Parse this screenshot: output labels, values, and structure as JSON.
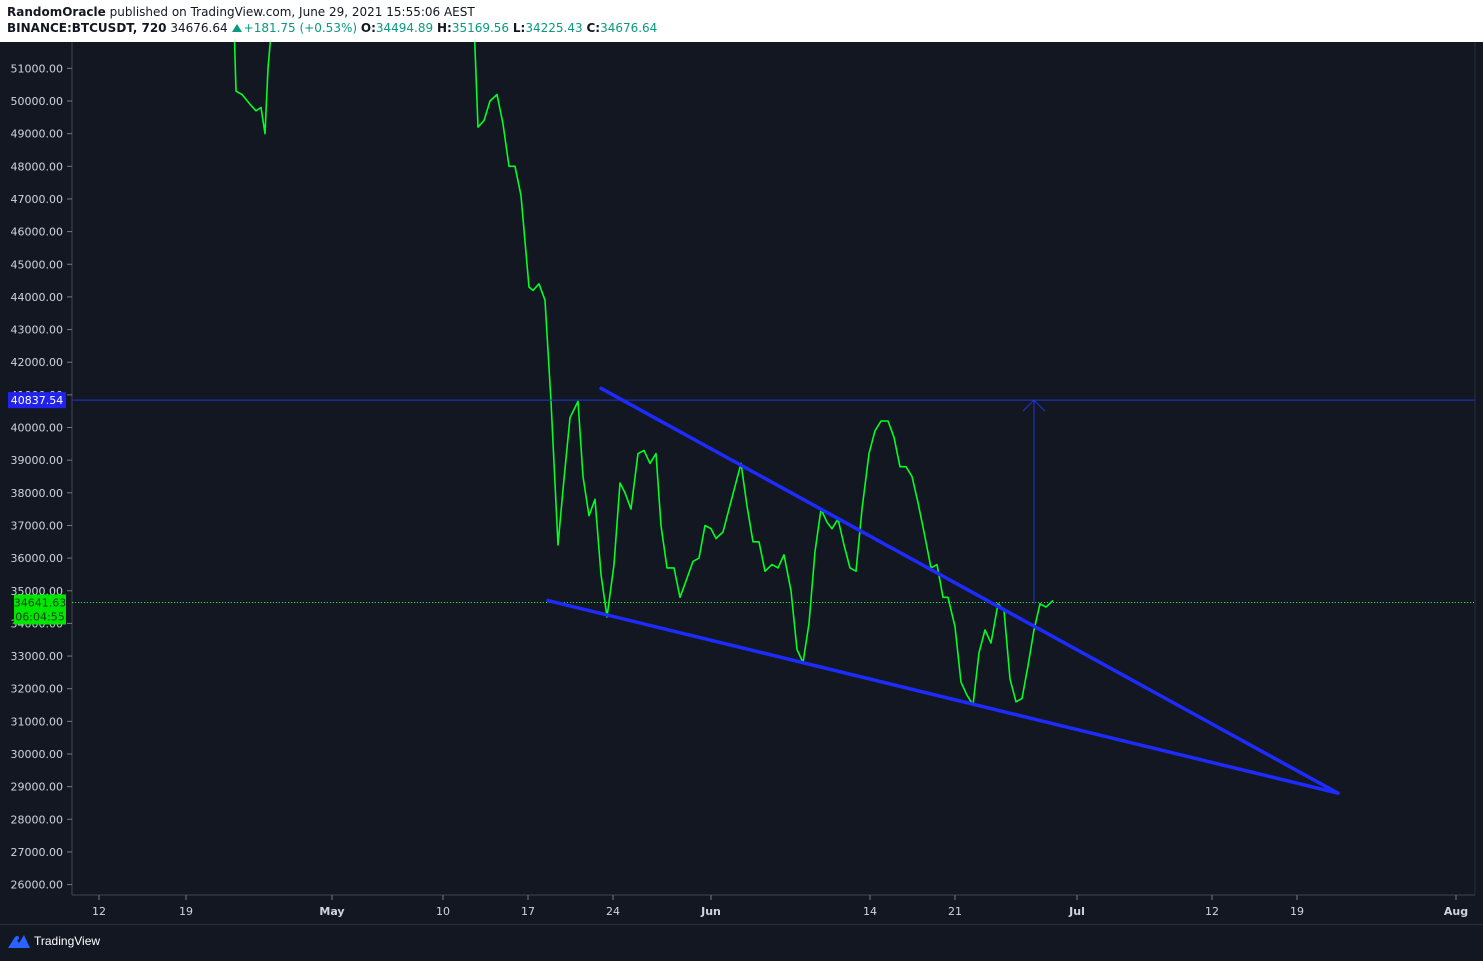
{
  "header": {
    "author": "RandomOracle",
    "published_text": "published on TradingView.com, June 29, 2021 15:55:06 AEST",
    "symbol": "BINANCE:BTCUSDT, 720",
    "last": "34676.64",
    "change": "+181.75 (+0.53%)",
    "open_label": "O:",
    "open": "34494.89",
    "high_label": "H:",
    "high": "35169.56",
    "low_label": "L:",
    "low": "34225.43",
    "close_label": "C:",
    "close": "34676.64"
  },
  "footer": {
    "brand": "TradingView"
  },
  "colors": {
    "background": "#131722",
    "price_line": "#00ff22",
    "trendlines": "#1e2bff",
    "target_line": "#2234d6",
    "price_marker": "#00e600"
  },
  "chart_data": {
    "type": "line",
    "ylim": [
      25700,
      52000
    ],
    "y_ticks": [
      26000,
      27000,
      28000,
      29000,
      30000,
      31000,
      32000,
      33000,
      34000,
      35000,
      36000,
      37000,
      38000,
      39000,
      40000,
      41000,
      42000,
      43000,
      44000,
      45000,
      46000,
      47000,
      48000,
      49000,
      50000,
      51000
    ],
    "x_ticks": [
      "12",
      "19",
      "May",
      "10",
      "17",
      "24",
      "Jun",
      "14",
      "21",
      "Jul",
      "12",
      "19",
      "Aug"
    ],
    "bold_x_ticks": [
      "May",
      "Jun",
      "Jul",
      "Aug"
    ],
    "series": [
      {
        "values": [
          [
            234,
            52500
          ],
          [
            236,
            50300
          ],
          [
            242,
            50200
          ],
          [
            250,
            49900
          ],
          [
            256,
            49700
          ],
          [
            261,
            49800
          ],
          [
            265,
            49000
          ],
          [
            268,
            51000
          ],
          [
            272,
            52500
          ],
          null,
          [
            474,
            52500
          ],
          [
            478,
            49200
          ],
          [
            484,
            49400
          ],
          [
            490,
            50000
          ],
          [
            497,
            50200
          ],
          [
            503,
            49300
          ],
          [
            509,
            48000
          ],
          [
            515,
            48000
          ],
          [
            521,
            47100
          ],
          [
            529,
            44300
          ],
          [
            533,
            44200
          ],
          [
            539,
            44400
          ],
          [
            545,
            43900
          ],
          [
            551,
            40800
          ],
          [
            558,
            36400
          ],
          [
            563,
            38100
          ],
          [
            570,
            40300
          ],
          [
            578,
            40800
          ],
          [
            583,
            38500
          ],
          [
            589,
            37300
          ],
          [
            595,
            37800
          ],
          [
            601,
            35500
          ],
          [
            607,
            34200
          ],
          [
            614,
            35800
          ],
          [
            620,
            38300
          ],
          [
            625,
            38000
          ],
          [
            631,
            37500
          ],
          [
            638,
            39200
          ],
          [
            644,
            39300
          ],
          [
            650,
            38900
          ],
          [
            656,
            39200
          ],
          [
            661,
            37000
          ],
          [
            667,
            35700
          ],
          [
            674,
            35700
          ],
          [
            680,
            34800
          ],
          [
            686,
            35300
          ],
          [
            693,
            35900
          ],
          [
            699,
            36000
          ],
          [
            705,
            37000
          ],
          [
            711,
            36900
          ],
          [
            716,
            36600
          ],
          [
            723,
            36800
          ],
          [
            729,
            37500
          ],
          [
            735,
            38200
          ],
          [
            741,
            38900
          ],
          [
            747,
            37600
          ],
          [
            753,
            36500
          ],
          [
            759,
            36500
          ],
          [
            765,
            35600
          ],
          [
            772,
            35800
          ],
          [
            778,
            35700
          ],
          [
            784,
            36100
          ],
          [
            791,
            35000
          ],
          [
            797,
            33200
          ],
          [
            803,
            32800
          ],
          [
            809,
            34000
          ],
          [
            815,
            36200
          ],
          [
            821,
            37500
          ],
          [
            827,
            37100
          ],
          [
            832,
            36900
          ],
          [
            838,
            37200
          ],
          [
            844,
            36400
          ],
          [
            850,
            35700
          ],
          [
            856,
            35600
          ],
          [
            862,
            37500
          ],
          [
            869,
            39200
          ],
          [
            875,
            39900
          ],
          [
            881,
            40200
          ],
          [
            888,
            40200
          ],
          [
            894,
            39700
          ],
          [
            900,
            38800
          ],
          [
            906,
            38800
          ],
          [
            912,
            38500
          ],
          [
            918,
            37700
          ],
          [
            924,
            36800
          ],
          [
            931,
            35700
          ],
          [
            937,
            35800
          ],
          [
            943,
            34800
          ],
          [
            948,
            34800
          ],
          [
            955,
            33900
          ],
          [
            961,
            32200
          ],
          [
            967,
            31800
          ],
          [
            973,
            31500
          ],
          [
            979,
            33100
          ],
          [
            985,
            33800
          ],
          [
            991,
            33400
          ],
          [
            998,
            34600
          ],
          [
            1004,
            34400
          ],
          [
            1010,
            32300
          ],
          [
            1016,
            31600
          ],
          [
            1022,
            31700
          ],
          [
            1028,
            32700
          ],
          [
            1034,
            33800
          ],
          [
            1040,
            34600
          ],
          [
            1046,
            34500
          ],
          [
            1053,
            34700
          ]
        ]
      }
    ],
    "trendlines": [
      {
        "from": [
          601,
          41200
        ],
        "to": [
          1338,
          28800
        ]
      },
      {
        "from": [
          548,
          34700
        ],
        "to": [
          1338,
          28800
        ]
      }
    ],
    "target_level": 40837.54,
    "projection": {
      "from": [
        1034,
        34600
      ],
      "to": [
        1034,
        40837.54
      ]
    },
    "last_price_marker": {
      "price": "34641.63",
      "countdown": "06:04:55"
    },
    "target_marker": "40837.54"
  }
}
